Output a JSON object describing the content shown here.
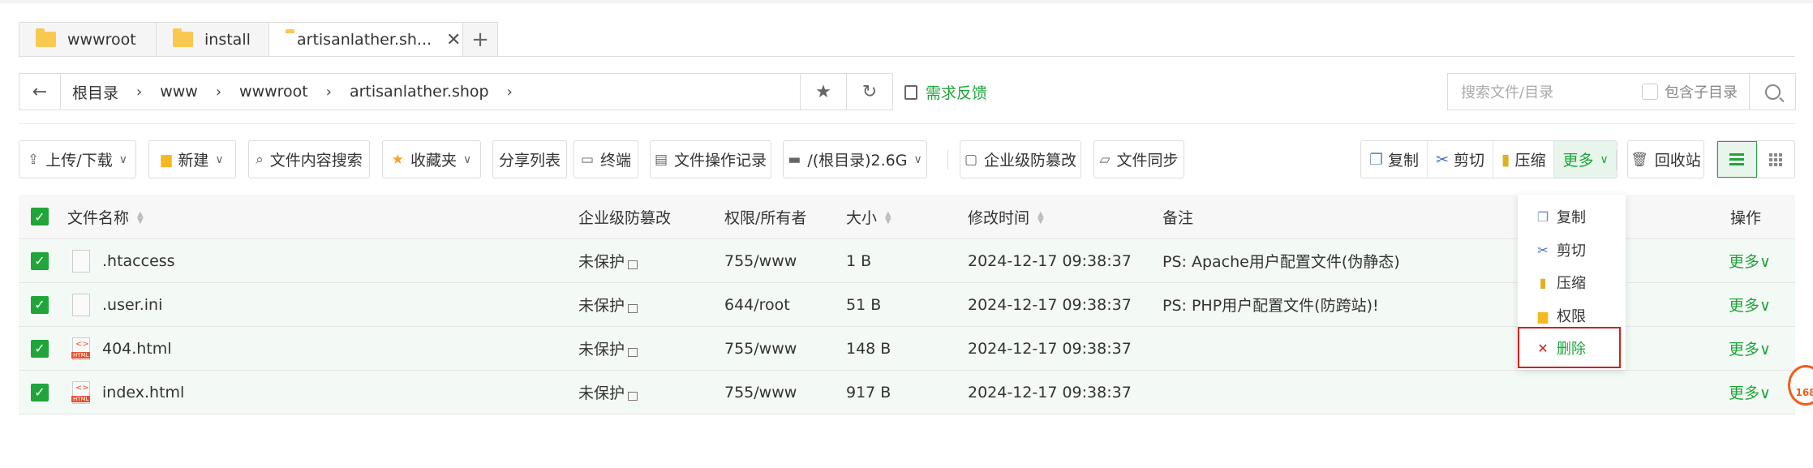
{
  "tabs": [
    {
      "label": "wwwroot"
    },
    {
      "label": "install"
    },
    {
      "label": "artisanlather.sh..."
    }
  ],
  "tab_close": "✕",
  "tab_add": "+",
  "breadcrumb": {
    "back": "←",
    "items": [
      "根目录",
      "www",
      "wwwroot",
      "artisanlather.shop"
    ],
    "sep": "›"
  },
  "favorite_icon": "★",
  "refresh_icon": "↻",
  "feedback": "需求反馈",
  "search": {
    "placeholder": "搜索文件/目录",
    "include_sub": "包含子目录"
  },
  "toolbar": {
    "upload": "上传/下载",
    "new": "新建",
    "content_search": "文件内容搜索",
    "favorites": "收藏夹",
    "share_list": "分享列表",
    "terminal": "终端",
    "op_log": "文件操作记录",
    "disk": "/(根目录)2.6G",
    "tamper": "企业级防篡改",
    "sync": "文件同步",
    "copy": "复制",
    "cut": "剪切",
    "compress": "压缩",
    "more": "更多",
    "recycle": "回收站"
  },
  "table": {
    "headers": {
      "name": "文件名称",
      "tamper": "企业级防篡改",
      "perm": "权限/所有者",
      "size": "大小",
      "mtime": "修改时间",
      "note": "备注",
      "op": "操作"
    },
    "rows": [
      {
        "name": ".htaccess",
        "tamper": "未保护",
        "perm": "755/www",
        "size": "1 B",
        "mtime": "2024-12-17 09:38:37",
        "note": "PS: Apache用户配置文件(伪静态)",
        "op": "更多∨",
        "icon": "file-icon"
      },
      {
        "name": ".user.ini",
        "tamper": "未保护",
        "perm": "644/root",
        "size": "51 B",
        "mtime": "2024-12-17 09:38:37",
        "note": "PS: PHP用户配置文件(防跨站)!",
        "op": "更多∨",
        "icon": "file-icon"
      },
      {
        "name": "404.html",
        "tamper": "未保护",
        "perm": "755/www",
        "size": "148 B",
        "mtime": "2024-12-17 09:38:37",
        "note": "",
        "op": "更多∨",
        "icon": "html-file-icon"
      },
      {
        "name": "index.html",
        "tamper": "未保护",
        "perm": "755/www",
        "size": "917 B",
        "mtime": "2024-12-17 09:38:37",
        "note": "",
        "op": "更多∨",
        "icon": "html-file-icon"
      }
    ]
  },
  "dropdown": {
    "items": [
      "复制",
      "剪切",
      "压缩",
      "权限",
      "删除"
    ]
  },
  "badge": "168",
  "colors": {
    "accent": "#20a53a",
    "danger": "#d0211c",
    "folder": "#f8c951"
  }
}
